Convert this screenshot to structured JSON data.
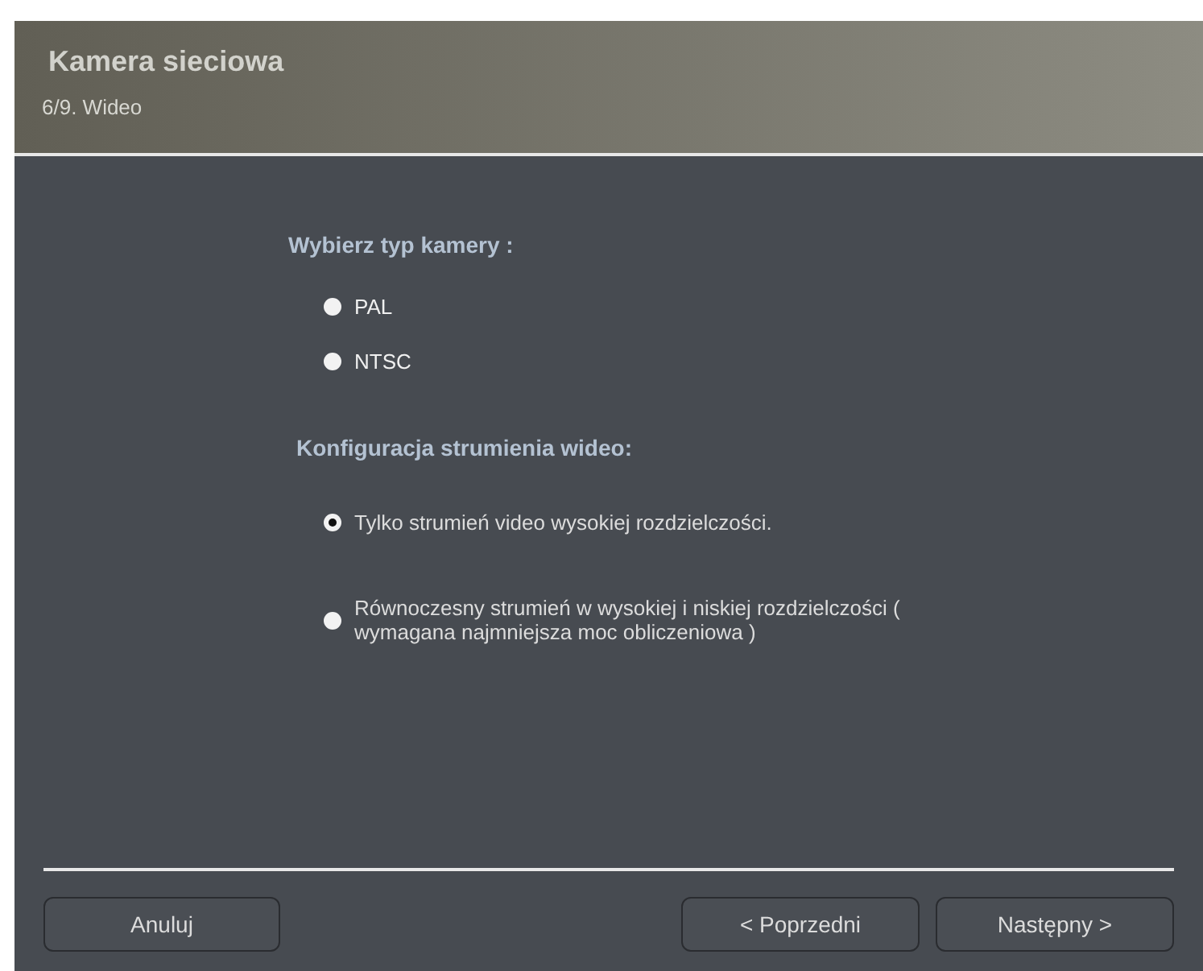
{
  "header": {
    "title": "Kamera sieciowa",
    "step": "6/9. Wideo"
  },
  "groups": [
    {
      "heading": "Wybierz typ kamery :",
      "options": [
        {
          "label": "PAL",
          "selected": false
        },
        {
          "label": "NTSC",
          "selected": false
        }
      ]
    },
    {
      "heading": "Konfiguracja strumienia wideo:",
      "options": [
        {
          "label": "Tylko strumień video wysokiej rozdzielczości.",
          "selected": true
        },
        {
          "label": "Równoczesny strumień w wysokiej i niskiej rozdzielczości ( wymagana najmniejsza moc obliczeniowa )",
          "selected": false
        }
      ]
    }
  ],
  "buttons": {
    "cancel": "Anuluj",
    "back": "< Poprzedni",
    "next": "Następny >"
  }
}
